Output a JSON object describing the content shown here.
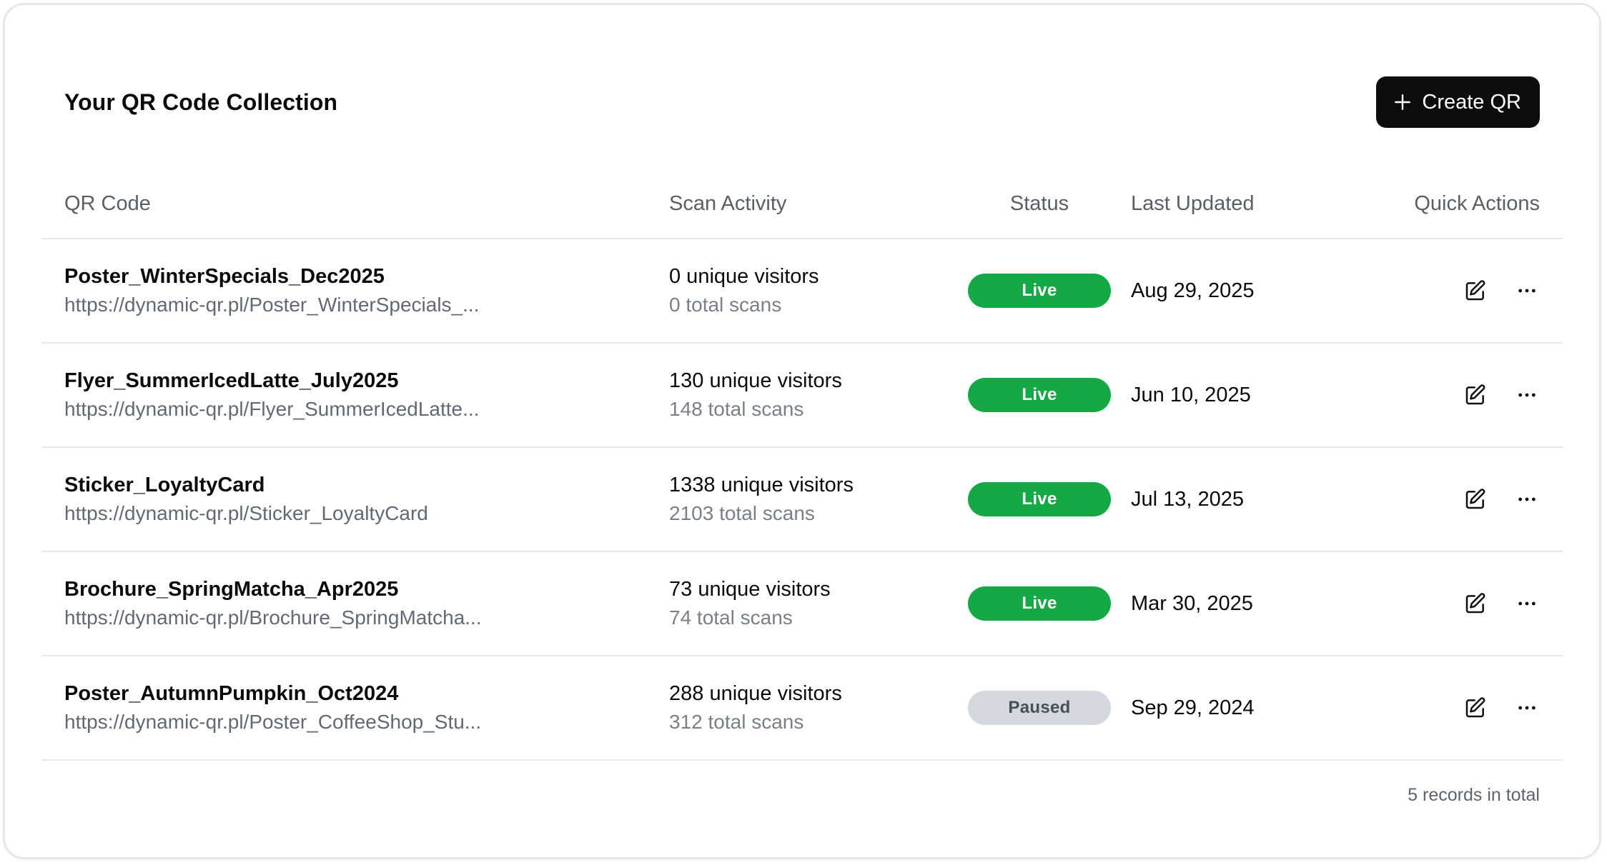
{
  "header": {
    "title": "Your QR Code Collection",
    "create_label": "Create QR"
  },
  "table": {
    "columns": {
      "qr_code": "QR Code",
      "scan_activity": "Scan Activity",
      "status": "Status",
      "last_updated": "Last Updated",
      "quick_actions": "Quick Actions"
    },
    "rows": [
      {
        "name": "Poster_WinterSpecials_Dec2025",
        "url": "https://dynamic-qr.pl/Poster_WinterSpecials_...",
        "visitors": "0 unique visitors",
        "scans": "0 total scans",
        "status": "Live",
        "updated": "Aug 29, 2025"
      },
      {
        "name": "Flyer_SummerIcedLatte_July2025",
        "url": "https://dynamic-qr.pl/Flyer_SummerIcedLatte...",
        "visitors": "130 unique visitors",
        "scans": "148 total scans",
        "status": "Live",
        "updated": "Jun 10, 2025"
      },
      {
        "name": "Sticker_LoyaltyCard",
        "url": "https://dynamic-qr.pl/Sticker_LoyaltyCard",
        "visitors": "1338 unique visitors",
        "scans": "2103 total scans",
        "status": "Live",
        "updated": "Jul 13, 2025"
      },
      {
        "name": "Brochure_SpringMatcha_Apr2025",
        "url": "https://dynamic-qr.pl/Brochure_SpringMatcha...",
        "visitors": "73 unique visitors",
        "scans": "74 total scans",
        "status": "Live",
        "updated": "Mar 30, 2025"
      },
      {
        "name": "Poster_AutumnPumpkin_Oct2024",
        "url": "https://dynamic-qr.pl/Poster_CoffeeShop_Stu...",
        "visitors": "288 unique visitors",
        "scans": "312 total scans",
        "status": "Paused",
        "updated": "Sep 29, 2024"
      }
    ]
  },
  "footer": {
    "records_total": "5 records in total"
  },
  "icons": {
    "create": "plus-icon",
    "edit": "edit-icon",
    "more": "more-horizontal-icon"
  },
  "colors": {
    "live": "#14a944",
    "paused": "#d4d7dc",
    "primary_button": "#0d0d0d"
  }
}
